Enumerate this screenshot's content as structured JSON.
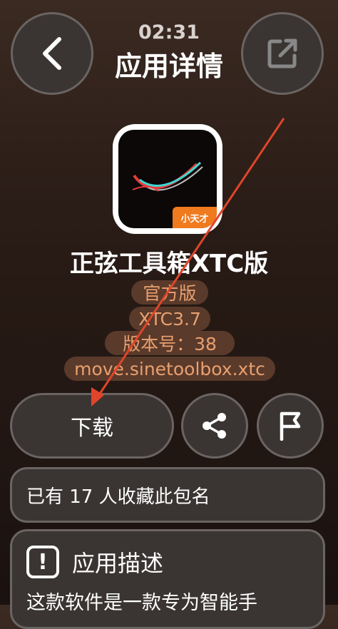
{
  "header": {
    "time": "02:31",
    "title": "应用详情",
    "back_icon": "chevron-left-icon",
    "external_icon": "open-external-icon"
  },
  "app": {
    "icon_badge": "小天才",
    "name": "正弦工具箱XTC版",
    "tags": [
      "官方版",
      "XTC3.7",
      "版本号：38",
      "move.sinetoolbox.xtc"
    ]
  },
  "actions": {
    "download_label": "下载",
    "share_icon": "share-icon",
    "report_icon": "flag-icon"
  },
  "favorites": {
    "text": "已有 17 人收藏此包名"
  },
  "description": {
    "title": "应用描述",
    "text": "这款软件是一款专为智能手"
  },
  "colors": {
    "tag_bg": "#5a3a2a",
    "tag_text": "#e8a070",
    "annotation_arrow": "#e0452a",
    "badge": "#f07a1e"
  }
}
